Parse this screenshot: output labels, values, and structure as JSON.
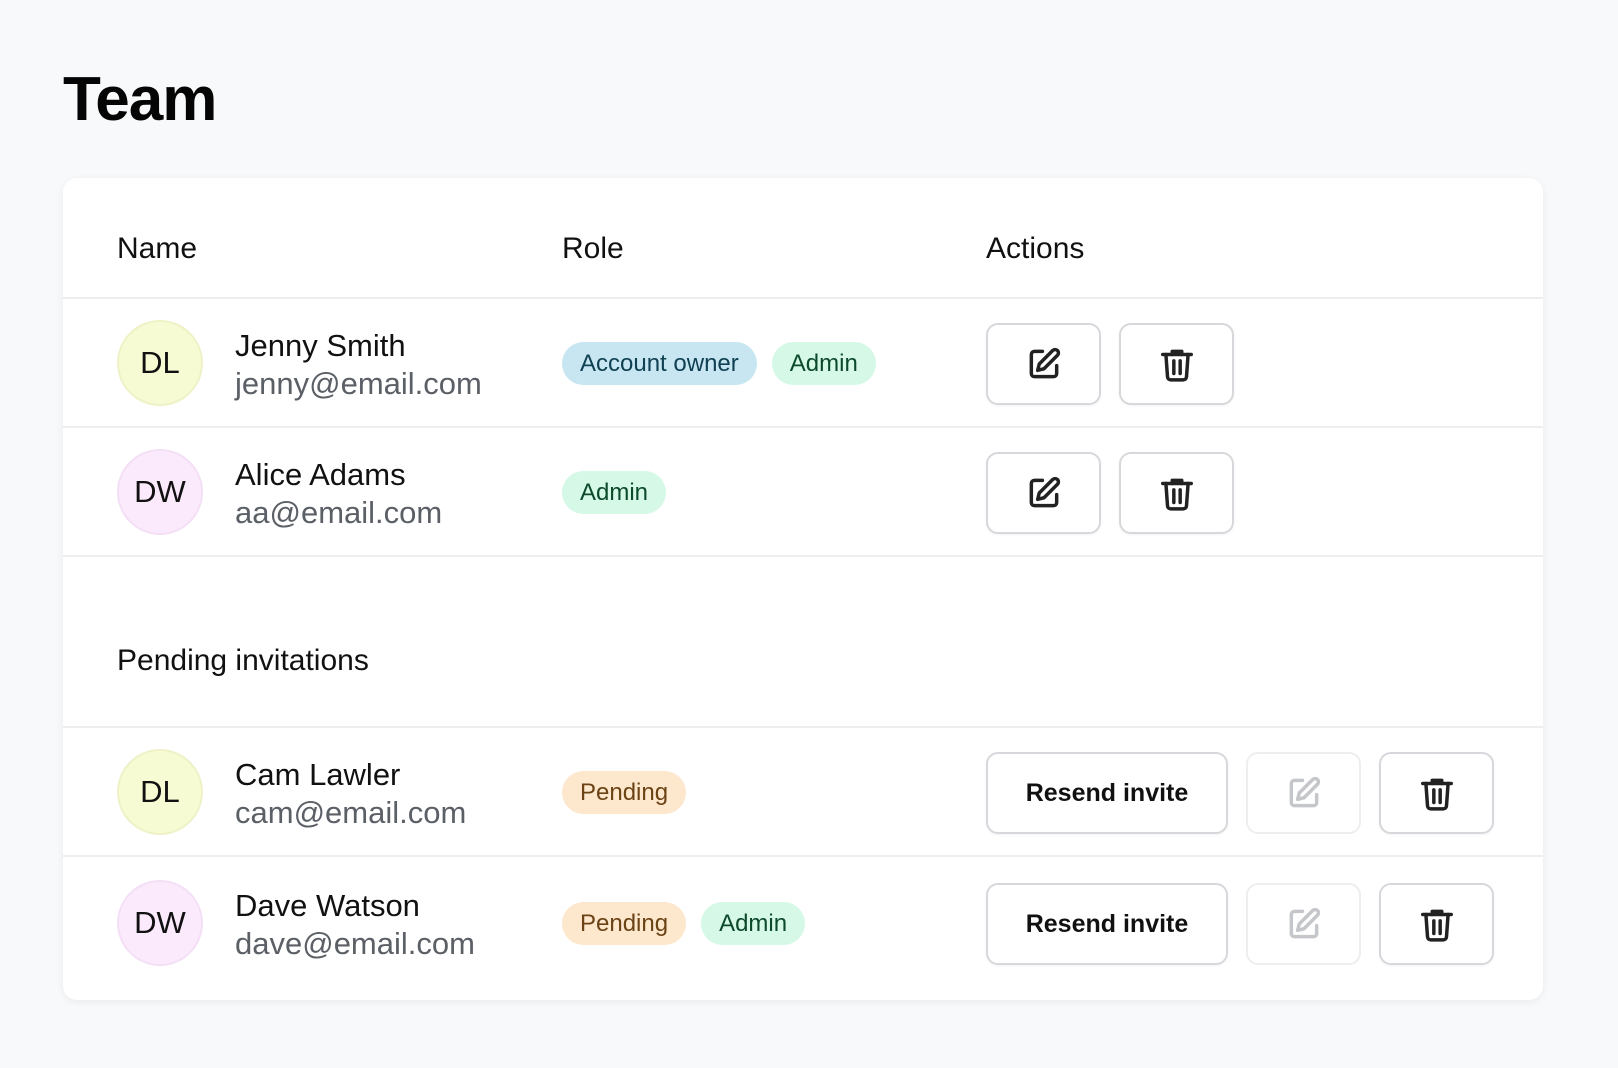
{
  "page": {
    "title": "Team"
  },
  "table": {
    "headers": {
      "name": "Name",
      "role": "Role",
      "actions": "Actions"
    },
    "members": [
      {
        "initials": "DL",
        "avatar_color": "#f6fbd3",
        "name": "Jenny Smith",
        "email": "jenny@email.com",
        "badges": [
          "Account owner",
          "Admin"
        ]
      },
      {
        "initials": "DW",
        "avatar_color": "#fbeafc",
        "name": "Alice Adams",
        "email": "aa@email.com",
        "badges": [
          "Admin"
        ]
      }
    ],
    "pending": {
      "title": "Pending invitations",
      "resend_label": "Resend invite",
      "items": [
        {
          "initials": "DL",
          "avatar_color": "#f6fbd3",
          "name": "Cam Lawler",
          "email": "cam@email.com",
          "badges": [
            "Pending"
          ]
        },
        {
          "initials": "DW",
          "avatar_color": "#fbeafc",
          "name": "Dave Watson",
          "email": "dave@email.com",
          "badges": [
            "Pending",
            "Admin"
          ]
        }
      ]
    }
  },
  "icons": {
    "edit": "edit-icon",
    "delete": "trash-icon"
  },
  "colors": {
    "badge_blue": "#c8e6f1",
    "badge_green": "#d6f8e6",
    "badge_orange": "#fde7cd"
  }
}
